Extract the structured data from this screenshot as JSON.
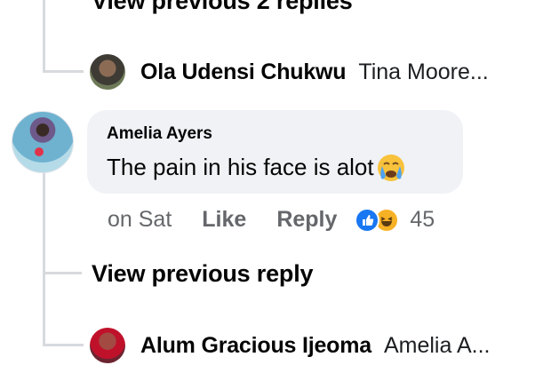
{
  "thread": {
    "view_previous_replies_top": "View previous 2 replies",
    "collapsed_reply_1": {
      "author": "Ola Udensi Chukwu",
      "preview": "Tina Moore..."
    },
    "comment": {
      "author": "Amelia Ayers",
      "text": "The pain in his face is alot",
      "emoji": "crying-face-emoji",
      "timestamp": "on Sat",
      "like_label": "Like",
      "reply_label": "Reply",
      "reactions": [
        "like-reaction-icon",
        "haha-reaction-icon"
      ],
      "reaction_count": "45"
    },
    "view_previous_reply": "View previous reply",
    "collapsed_reply_2": {
      "author": "Alum Gracious Ijeoma",
      "preview": "Amelia A..."
    }
  },
  "colors": {
    "bubble_bg": "#f0f2f5",
    "muted_text": "#65676b",
    "primary_text": "#050505",
    "like_blue": "#1877f2",
    "haha_yellow": "#f7b125",
    "thread_line": "#d7d9dd"
  }
}
